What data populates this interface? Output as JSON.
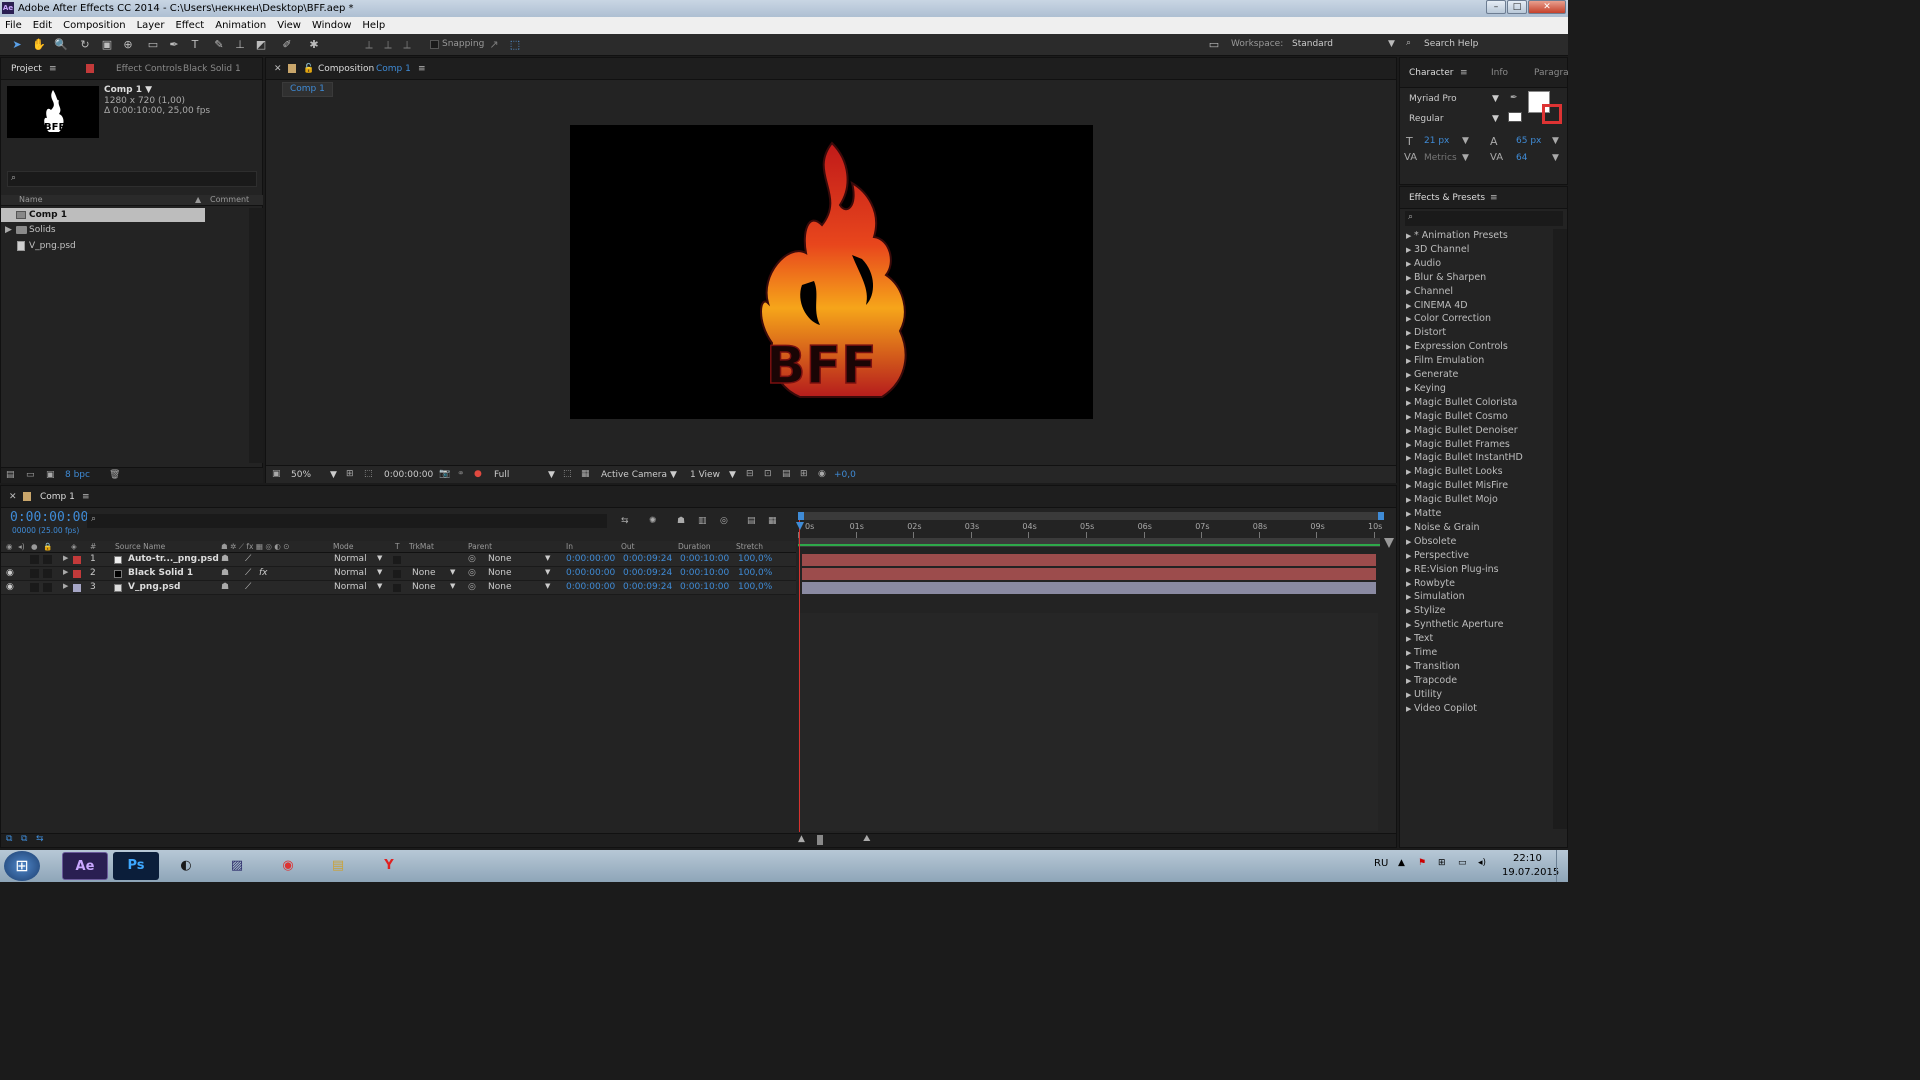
{
  "window": {
    "title": "Adobe After Effects CC 2014 - C:\\Users\\некнкен\\Desktop\\BFF.aep *",
    "min": "–",
    "max": "□",
    "close": "✕"
  },
  "menu": [
    "File",
    "Edit",
    "Composition",
    "Layer",
    "Effect",
    "Animation",
    "View",
    "Window",
    "Help"
  ],
  "toolbar": {
    "snapping": "Snapping",
    "workspace_label": "Workspace:",
    "workspace_value": "Standard",
    "search_help": "Search Help"
  },
  "project_panel": {
    "tab_project": "Project",
    "tab_effect_controls": "Effect Controls",
    "effect_controls_target": "Black Solid 1",
    "comp_name": "Comp 1 ▼",
    "comp_dims": "1280 x 720 (1,00)",
    "comp_duration": "Δ 0:00:10:00, 25,00 fps",
    "col_name": "Name",
    "col_comment": "Comment",
    "items": [
      {
        "name": "Comp 1",
        "type": "comp"
      },
      {
        "name": "Solids",
        "type": "folder"
      },
      {
        "name": "V_png.psd",
        "type": "file"
      }
    ],
    "bpc": "8 bpc"
  },
  "composition_panel": {
    "tab_label": "Composition",
    "tab_comp": "Comp 1",
    "sub_tab": "Comp 1",
    "zoom": "50%",
    "timecode": "0:00:00:00",
    "resolution": "Full",
    "camera": "Active Camera",
    "views": "1 View",
    "exposure": "+0,0",
    "logo_text": "BFF"
  },
  "character_panel": {
    "tab_character": "Character",
    "tab_info": "Info",
    "tab_paragraph": "Paragra",
    "font": "Myriad Pro",
    "style": "Regular",
    "size": "21 px",
    "leading": "65 px",
    "kerning": "Metrics",
    "tracking": "64"
  },
  "effects_panel": {
    "title": "Effects & Presets",
    "items": [
      "* Animation Presets",
      "3D Channel",
      "Audio",
      "Blur & Sharpen",
      "Channel",
      "CINEMA 4D",
      "Color Correction",
      "Distort",
      "Expression Controls",
      "Film Emulation",
      "Generate",
      "Keying",
      "Magic Bullet Colorista",
      "Magic Bullet Cosmo",
      "Magic Bullet Denoiser",
      "Magic Bullet Frames",
      "Magic Bullet InstantHD",
      "Magic Bullet Looks",
      "Magic Bullet MisFire",
      "Magic Bullet Mojo",
      "Matte",
      "Noise & Grain",
      "Obsolete",
      "Perspective",
      "RE:Vision Plug-ins",
      "Rowbyte",
      "Simulation",
      "Stylize",
      "Synthetic Aperture",
      "Text",
      "Time",
      "Transition",
      "Trapcode",
      "Utility",
      "Video Copilot"
    ]
  },
  "timeline": {
    "tab": "Comp 1",
    "timecode": "0:00:00:00",
    "frames": "00000 (25.00 fps)",
    "headers": {
      "num": "#",
      "source": "Source Name",
      "mode": "Mode",
      "t": "T",
      "trkmat": "TrkMat",
      "parent": "Parent",
      "in": "In",
      "out": "Out",
      "duration": "Duration",
      "stretch": "Stretch"
    },
    "ruler": [
      "0s",
      "01s",
      "02s",
      "03s",
      "04s",
      "05s",
      "06s",
      "07s",
      "08s",
      "09s",
      "10s"
    ],
    "layers": [
      {
        "num": "1",
        "name": "Auto-tr..._png.psd",
        "mode": "Normal",
        "trkmat": "",
        "parent": "None",
        "in": "0:00:00:00",
        "out": "0:00:09:24",
        "duration": "0:00:10:00",
        "stretch": "100,0%",
        "color": "#c33a3a",
        "bar": "#9c4c4c",
        "fx": ""
      },
      {
        "num": "2",
        "name": "Black Solid 1",
        "mode": "Normal",
        "trkmat": "None",
        "parent": "None",
        "in": "0:00:00:00",
        "out": "0:00:09:24",
        "duration": "0:00:10:00",
        "stretch": "100,0%",
        "color": "#c33a3a",
        "bar": "#9c4c4c",
        "fx": "fx"
      },
      {
        "num": "3",
        "name": "V_png.psd",
        "mode": "Normal",
        "trkmat": "None",
        "parent": "None",
        "in": "0:00:00:00",
        "out": "0:00:09:24",
        "duration": "0:00:10:00",
        "stretch": "100,0%",
        "color": "#a6a6c6",
        "bar": "#8a8aa2",
        "fx": ""
      }
    ]
  },
  "taskbar": {
    "lang": "RU",
    "time": "22:10",
    "date": "19.07.2015"
  }
}
